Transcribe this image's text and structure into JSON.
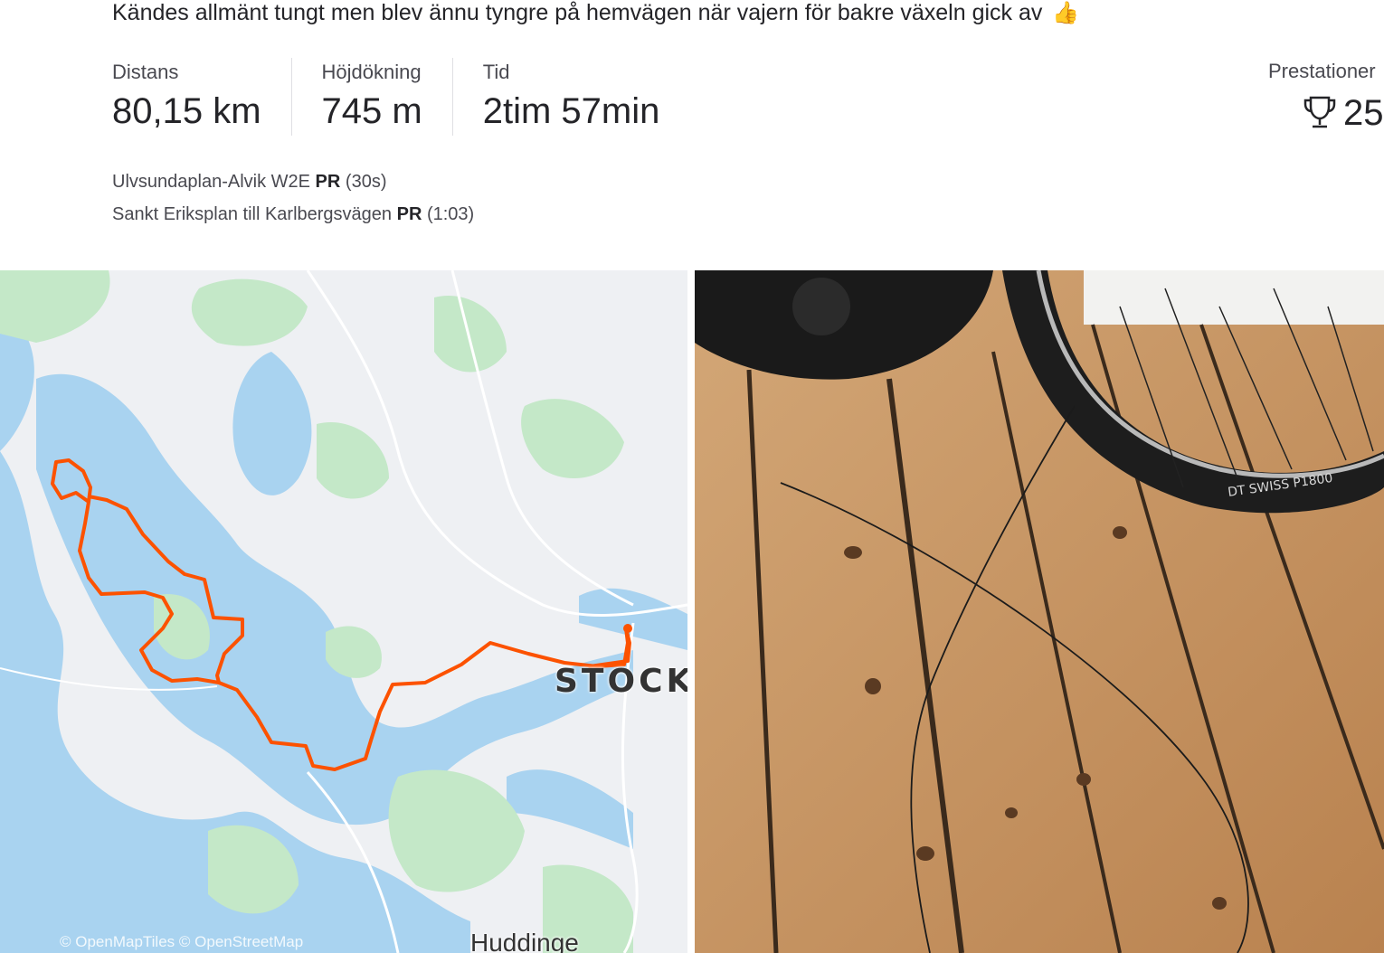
{
  "activity": {
    "description": "Kändes allmänt tungt men blev ännu tyngre på hemvägen när vajern för bakre växeln gick av",
    "description_emoji": "👍"
  },
  "stats": [
    {
      "label": "Distans",
      "value": "80,15 km"
    },
    {
      "label": "Höjdökning",
      "value": "745 m"
    },
    {
      "label": "Tid",
      "value": "2tim 57min"
    }
  ],
  "achievements": {
    "label": "Prestationer",
    "count": "25",
    "icon": "trophy-icon"
  },
  "segments": [
    {
      "name": "Ulvsundaplan-Alvik W2E",
      "badge": "PR",
      "time": "(30s)"
    },
    {
      "name": "Sankt Eriksplan till Karlbergsvägen",
      "badge": "PR",
      "time": "(1:03)"
    }
  ],
  "map": {
    "city_label": "STOCK",
    "town_label": "Huddinge",
    "attribution": "© OpenMapTiles © OpenStreetMap",
    "route_color": "#fc5200",
    "water_color": "#a9d3f0",
    "park_color": "#c4e8c8"
  },
  "photo": {
    "tire_text": "DT SWISS P1800"
  }
}
